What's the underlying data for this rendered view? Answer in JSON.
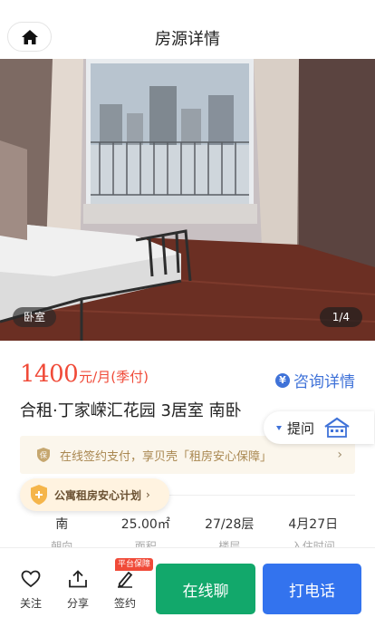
{
  "header": {
    "title": "房源详情"
  },
  "gallery": {
    "tag": "卧室",
    "counter": "1/4"
  },
  "listing": {
    "price": "1400",
    "price_unit": "元/月(季付)",
    "consult_label": "咨询详情",
    "title": "合租·丁家嵘汇花园 3居室 南卧",
    "question_label": "提问"
  },
  "guarantee": {
    "text": "在线签约支付，享贝壳「租房安心保障」"
  },
  "plan_chip": {
    "text": "公寓租房安心计划"
  },
  "facts": [
    {
      "value": "南",
      "label": "朝向"
    },
    {
      "value": "25.00㎡",
      "label": "面积"
    },
    {
      "value": "27/28层",
      "label": "楼层"
    },
    {
      "value": "4月27日",
      "label": "入住时间"
    }
  ],
  "bottom_bar": {
    "follow_label": "关注",
    "share_label": "分享",
    "sign_label": "签约",
    "platform_badge": "平台保障",
    "chat_label": "在线聊",
    "call_label": "打电话"
  },
  "colors": {
    "price": "#f04a38",
    "link_blue": "#3f72d8",
    "chat_green": "#12a86b",
    "call_blue": "#3373ee",
    "guarantee_bg": "#fbf6ec"
  }
}
